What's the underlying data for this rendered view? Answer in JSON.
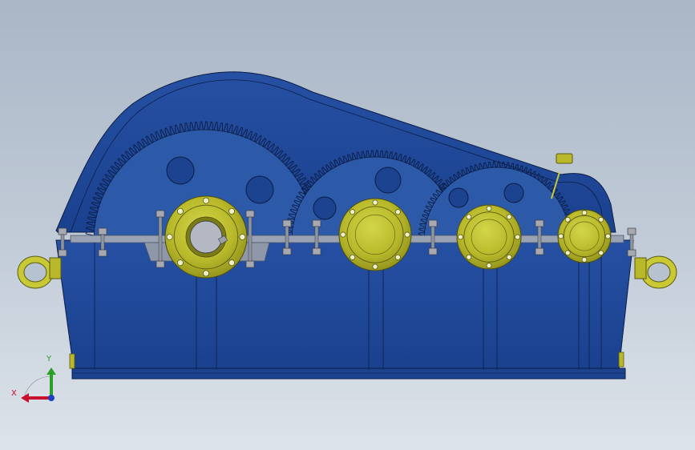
{
  "viewport": {
    "background_top": "#a9b6c6",
    "background_bottom": "#dde3ea"
  },
  "colors": {
    "housing_blue": "#1f4a9c",
    "housing_dark": "#163b82",
    "gear_blue": "#2d5aa8",
    "flange_yellow": "#b8b82a",
    "flange_dark": "#8e8e1c",
    "bolt_gray": "#a8a8b0",
    "joint_gray": "#9aa3b4",
    "axis_x": "#c8102e",
    "axis_y": "#2aa02a",
    "axis_z": "#1f3fbf"
  },
  "model": {
    "name_icon": "gearbox-3d-model-icon"
  },
  "triad": {
    "x_label": "X",
    "y_label": "Y"
  }
}
